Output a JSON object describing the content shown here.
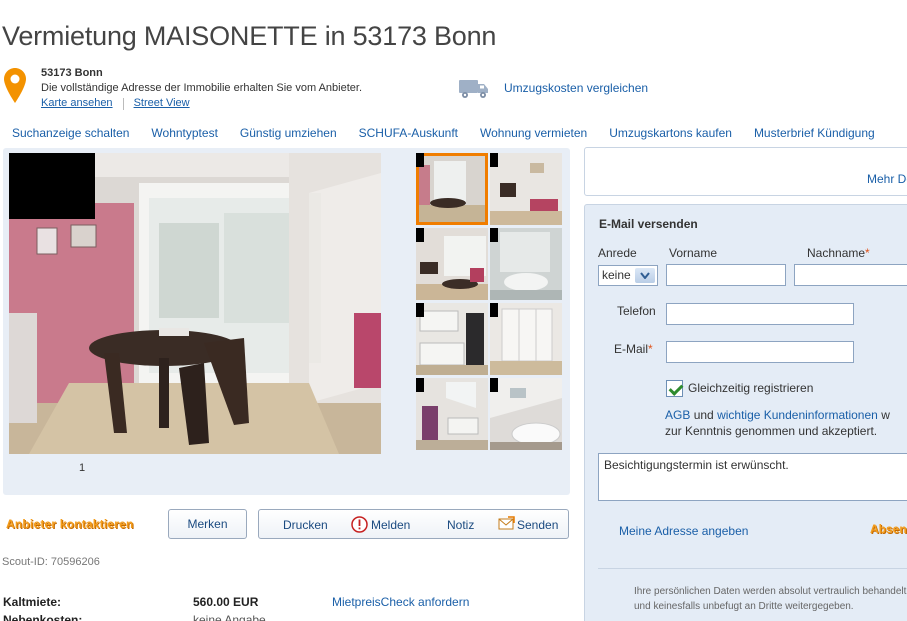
{
  "title": "Vermietung MAISONETTE in 53173 Bonn",
  "address": {
    "zip": "53173 Bonn",
    "note": "Die vollständige Adresse der Immobilie erhalten Sie vom Anbieter.",
    "map_link": "Karte ansehen",
    "street_view_link": "Street View"
  },
  "moving_costs_link": "Umzugskosten vergleichen",
  "nav": [
    "Suchanzeige schalten",
    "Wohntyptest",
    "Günstig umziehen",
    "SCHUFA-Auskunft",
    "Wohnung vermieten",
    "Umzugskartons kaufen",
    "Musterbrief Kündigung"
  ],
  "gallery": {
    "counter": "1"
  },
  "actions": {
    "contact": "Anbieter kontaktieren",
    "merken": "Merken",
    "drucken": "Drucken",
    "melden": "Melden",
    "notiz": "Notiz",
    "senden": "Senden"
  },
  "scout_id": "Scout-ID: 70596206",
  "details": {
    "kaltmiete_label": "Kaltmiete:",
    "kaltmiete_value": "560.00 EUR",
    "mietpreis_link": "MietpreisCheck anfordern",
    "nebenkosten_label": "Nebenkosten:",
    "nebenkosten_value": "keine Angabe"
  },
  "side_top": {
    "mehr": "Mehr Details"
  },
  "email_form": {
    "title": "E-Mail versenden",
    "anrede_label": "Anrede",
    "anrede_value": "keine",
    "vorname_label": "Vorname",
    "nachname_label": "Nachname",
    "telefon_label": "Telefon",
    "email_label": "E-Mail",
    "register_label": "Gleichzeitig registrieren",
    "agb_link": "AGB",
    "agb_and": "und",
    "kunden_link": "wichtige Kundeninformationen",
    "agb_tail": "w",
    "agb_line2": "zur Kenntnis genommen und akzeptiert.",
    "message": "Besichtigungstermin ist erwünscht.",
    "my_address_link": "Meine Adresse angeben",
    "submit": "Absenden",
    "privacy_line1": "Ihre persönlichen Daten werden absolut vertraulich behandelt",
    "privacy_line2": "und keinesfalls unbefugt an Dritte weitergegeben."
  },
  "colors": {
    "link": "#1a5fa8",
    "accent": "#f07d00",
    "panel": "#e4ecf6"
  }
}
